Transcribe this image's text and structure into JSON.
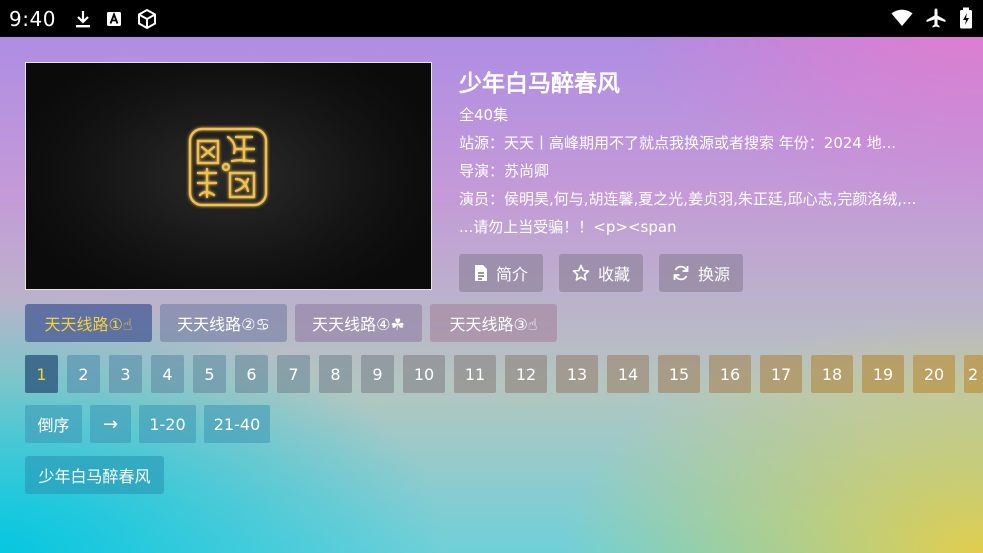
{
  "status": {
    "time": "9:40"
  },
  "detail": {
    "title": "少年白马醉春风",
    "episodes_total": "全40集",
    "source_line": "站源：天天丨高峰期用不了就点我换源或者搜索  年份：2024  地...",
    "director": "导演：苏尚卿",
    "cast": "演员：侯明昊,何与,胡连馨,夏之光,姜贞羽,朱正廷,邱心志,完颜洛绒,...",
    "desc_tail": "...请勿上当受骗！！<p><span"
  },
  "actions": {
    "intro": "简介",
    "favorite": "收藏",
    "switch_source": "换源"
  },
  "routes": [
    "天天线路①☝",
    "天天线路②♋",
    "天天线路④☘",
    "天天线路③☝"
  ],
  "episodes": [
    "1",
    "2",
    "3",
    "4",
    "5",
    "6",
    "7",
    "8",
    "9",
    "10",
    "11",
    "12",
    "13",
    "14",
    "15",
    "16",
    "17",
    "18",
    "19",
    "20",
    "2"
  ],
  "controls": {
    "reverse": "倒序",
    "arrow": "→",
    "range1": "1-20",
    "range2": "21-40"
  },
  "source_item": "少年白马醉春风"
}
